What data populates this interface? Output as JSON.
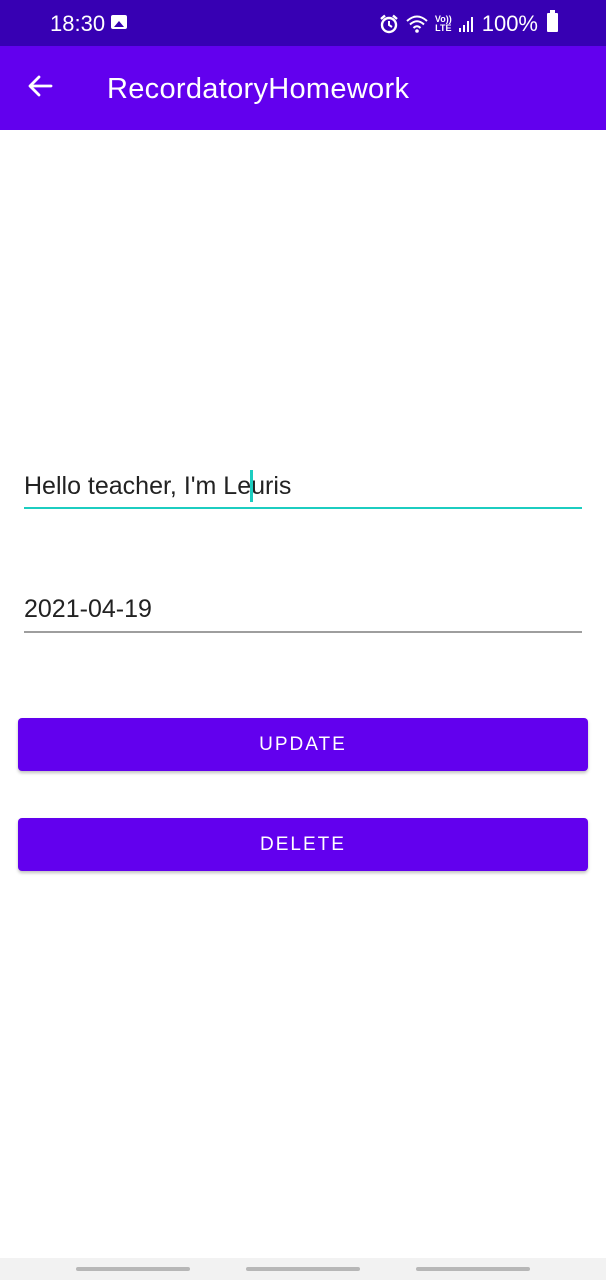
{
  "status_bar": {
    "time": "18:30",
    "volte_top": "Vo))",
    "volte_bottom": "LTE",
    "battery": "100%",
    "icons": [
      "gallery-icon",
      "alarm-icon",
      "wifi-icon",
      "volte-icon",
      "signal-icon",
      "battery-icon"
    ]
  },
  "app_bar": {
    "title": "RecordatoryHomework",
    "back_icon": "arrow-left-icon"
  },
  "form": {
    "note_value": "Hello teacher, I'm Leuris",
    "date_value": "2021-04-19"
  },
  "buttons": {
    "update_label": "Update",
    "delete_label": "Delete"
  },
  "colors": {
    "status_bar": "#3700b3",
    "primary": "#6200ee",
    "accent": "#1ccdc0"
  }
}
